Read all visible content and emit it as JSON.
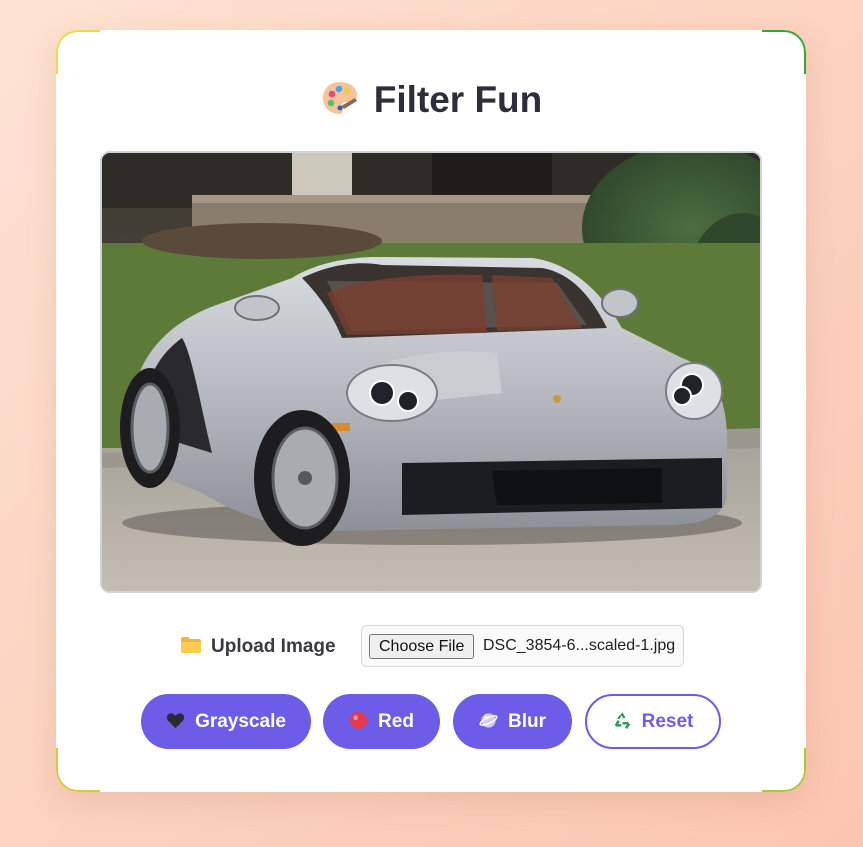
{
  "app": {
    "title": "Filter Fun",
    "title_icon": "palette-icon"
  },
  "preview": {
    "image_description_icon": "car-photo",
    "colors": {
      "body": "#b9bcc2",
      "grass": "#5f7a3a",
      "wall": "#8e8170",
      "road": "#b3aea6"
    }
  },
  "upload": {
    "label": "Upload Image",
    "icon": "folder-icon",
    "choose_label": "Choose File",
    "file_name": "DSC_3854-6...scaled-1.jpg"
  },
  "filters": [
    {
      "label": "Grayscale",
      "icon": "black-heart-icon"
    },
    {
      "label": "Red",
      "icon": "red-circle-icon"
    },
    {
      "label": "Blur",
      "icon": "blur-icon"
    }
  ],
  "reset": {
    "label": "Reset",
    "icon": "recycle-icon"
  },
  "theme": {
    "accent": "#6c5ce7",
    "background": "#fcd3c0"
  }
}
